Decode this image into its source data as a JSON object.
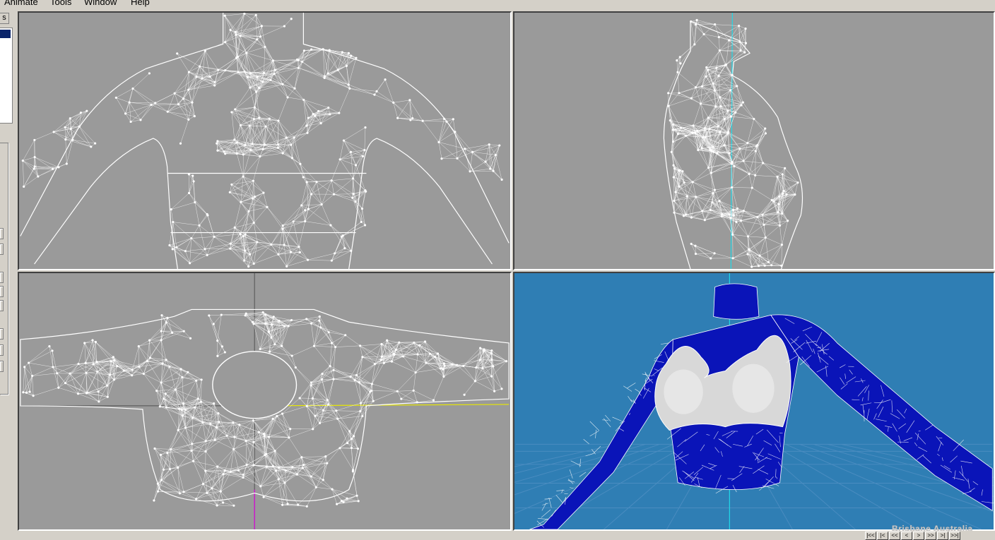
{
  "menu": {
    "items": [
      "Animate",
      "Tools",
      "Window",
      "Help"
    ]
  },
  "left_panel": {
    "tab_label": "s"
  },
  "watermark": "Brisbane Australia",
  "playback": [
    "|<<",
    "|<",
    "<<",
    "<",
    ">",
    ">>",
    ">|",
    ">>|"
  ],
  "colors": {
    "viewport_bg": "#9a9a9a",
    "perspective_bg": "#2f7eb4",
    "mesh": "#ffffff",
    "shirt": "#0a14b8",
    "bra": "#d8d8d8",
    "axis_cyan": "#20d8e8",
    "axis_yellow": "#e8e800",
    "axis_magenta": "#e000e0"
  },
  "viewports": [
    {
      "name": "front",
      "icon": "front-view-wireframe"
    },
    {
      "name": "side",
      "icon": "side-view-wireframe"
    },
    {
      "name": "top",
      "icon": "top-view-wireframe"
    },
    {
      "name": "perspective",
      "icon": "shaded-3d-model"
    }
  ]
}
